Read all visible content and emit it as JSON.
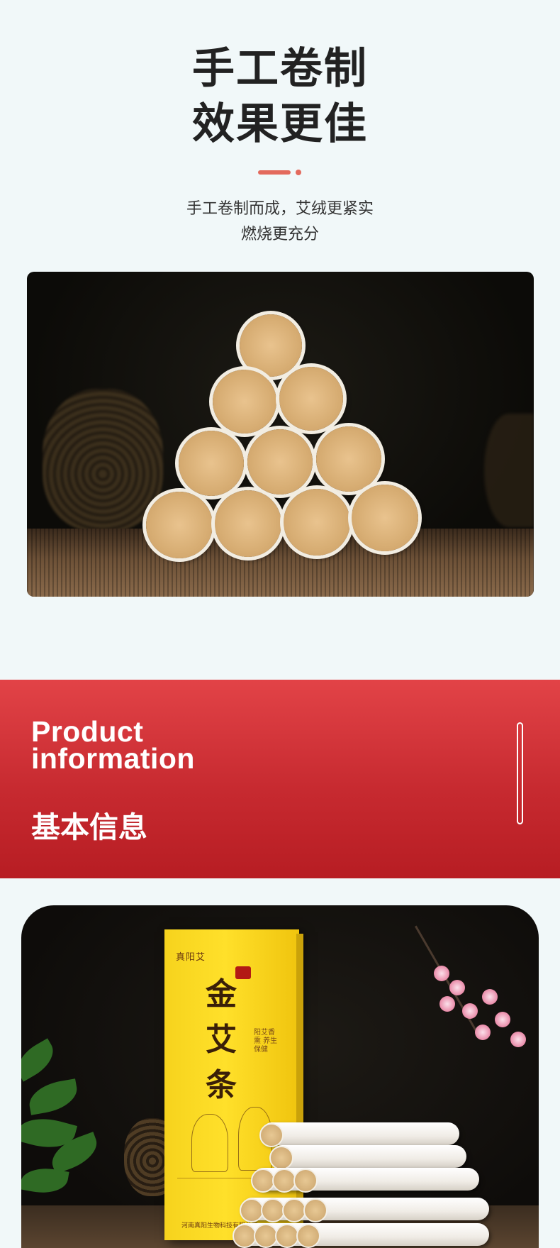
{
  "hero": {
    "title_line1": "手工卷制",
    "title_line2": "效果更佳",
    "desc_line1": "手工卷制而成，艾绒更紧实",
    "desc_line2": "燃烧更充分"
  },
  "colors": {
    "page_bg": "#f1f8f9",
    "accent": "#e36a5d",
    "banner_top": "#e24347",
    "banner_bottom": "#b71d23",
    "box_yellow": "#ffe02a"
  },
  "banner": {
    "title_en_line1": "Product",
    "title_en_line2": "information",
    "title_cn": "基本信息"
  },
  "product_box": {
    "brand": "真阳艾",
    "name": [
      "金",
      "艾",
      "条"
    ],
    "side_text": "阳艾香熏 养生保健",
    "footer": "河南真阳生物科技有限公司"
  },
  "images": {
    "photo1": "moxa-stick-pyramid-photo",
    "photo2": "moxa-box-product-photo"
  }
}
